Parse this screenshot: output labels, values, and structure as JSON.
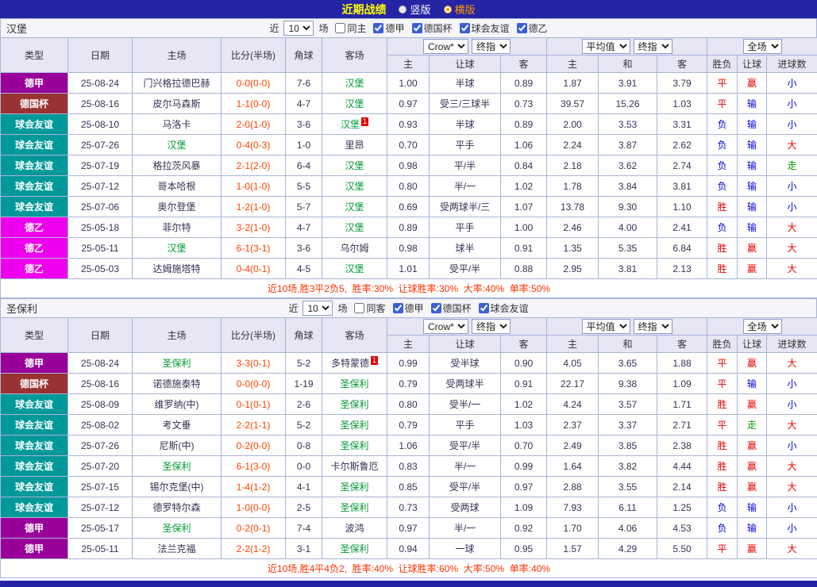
{
  "topbar": {
    "title": "近期战绩",
    "vertical_label": "竖版",
    "horizontal_label": "横版"
  },
  "columns": {
    "main": [
      "类型",
      "日期",
      "主场",
      "比分(半场)",
      "角球",
      "客场"
    ],
    "group1_selects": [
      "Crow*",
      "终指"
    ],
    "group1_cols": [
      "主",
      "让球",
      "客"
    ],
    "group2_selects": [
      "平均值",
      "终指"
    ],
    "group2_cols": [
      "主",
      "和",
      "客"
    ],
    "group3_selects": [
      "全场"
    ],
    "group3_cols": [
      "胜负",
      "让球",
      "进球数"
    ]
  },
  "league_colors": {
    "德甲": "#990099",
    "德国杯": "#993333",
    "球会友谊": "#009999",
    "德乙": "#ee00ee"
  },
  "colors": {
    "topbar-bg": "#2424a4",
    "title": "#ffff00",
    "radio-selected": "#ff9900",
    "border": "#a9b4d8",
    "header-bg": "#e6e6f4",
    "bar-bg": "#f5f5fa",
    "score": "#ff4400",
    "focus": "#009933",
    "dark": "#333355",
    "res-red": "#e60000",
    "res-blue": "#0000dd",
    "res-green": "#009900",
    "summary": "#ff3300"
  },
  "sections": [
    {
      "team": "汉堡",
      "filter": {
        "near": "近",
        "count": "10",
        "unit": "场",
        "checks": [
          {
            "label": "同主",
            "checked": false
          },
          {
            "label": "德甲",
            "checked": true
          },
          {
            "label": "德国杯",
            "checked": true
          },
          {
            "label": "球会友谊",
            "checked": true
          },
          {
            "label": "德乙",
            "checked": true
          }
        ]
      },
      "rows": [
        {
          "league": "德甲",
          "date": "25-08-24",
          "home": "门兴格拉德巴赫",
          "home_focus": false,
          "home_card": "",
          "score": "0-0(0-0)",
          "corner": "7-6",
          "away": "汉堡",
          "away_focus": true,
          "away_card": "",
          "o1": "1.00",
          "hcp": "半球",
          "o2": "0.89",
          "m1": "1.87",
          "m2": "3.91",
          "m3": "3.79",
          "res": "平",
          "resC": "red",
          "let": "赢",
          "letC": "red",
          "goal": "小",
          "goalC": "blue"
        },
        {
          "league": "德国杯",
          "date": "25-08-16",
          "home": "皮尔马森斯",
          "home_focus": false,
          "home_card": "",
          "score": "1-1(0-0)",
          "corner": "4-7",
          "away": "汉堡",
          "away_focus": true,
          "away_card": "",
          "o1": "0.97",
          "hcp": "受三/三球半",
          "o2": "0.73",
          "m1": "39.57",
          "m2": "15.26",
          "m3": "1.03",
          "res": "平",
          "resC": "red",
          "let": "输",
          "letC": "blue",
          "goal": "小",
          "goalC": "blue"
        },
        {
          "league": "球会友谊",
          "date": "25-08-10",
          "home": "马洛卡",
          "home_focus": false,
          "home_card": "",
          "score": "2-0(1-0)",
          "corner": "3-6",
          "away": "汉堡",
          "away_focus": true,
          "away_card": "1",
          "o1": "0.93",
          "hcp": "半球",
          "o2": "0.89",
          "m1": "2.00",
          "m2": "3.53",
          "m3": "3.31",
          "res": "负",
          "resC": "blue",
          "let": "输",
          "letC": "blue",
          "goal": "小",
          "goalC": "blue"
        },
        {
          "league": "球会友谊",
          "date": "25-07-26",
          "home": "汉堡",
          "home_focus": true,
          "home_card": "",
          "score": "0-4(0-3)",
          "corner": "1-0",
          "away": "里昂",
          "away_focus": false,
          "away_card": "",
          "o1": "0.70",
          "hcp": "平手",
          "o2": "1.06",
          "m1": "2.24",
          "m2": "3.87",
          "m3": "2.62",
          "res": "负",
          "resC": "blue",
          "let": "输",
          "letC": "blue",
          "goal": "大",
          "goalC": "red"
        },
        {
          "league": "球会友谊",
          "date": "25-07-19",
          "home": "格拉茨风暴",
          "home_focus": false,
          "home_card": "",
          "score": "2-1(2-0)",
          "corner": "6-4",
          "away": "汉堡",
          "away_focus": true,
          "away_card": "",
          "o1": "0.98",
          "hcp": "平/半",
          "o2": "0.84",
          "m1": "2.18",
          "m2": "3.62",
          "m3": "2.74",
          "res": "负",
          "resC": "blue",
          "let": "输",
          "letC": "blue",
          "goal": "走",
          "goalC": "green"
        },
        {
          "league": "球会友谊",
          "date": "25-07-12",
          "home": "哥本哈根",
          "home_focus": false,
          "home_card": "",
          "score": "1-0(1-0)",
          "corner": "5-5",
          "away": "汉堡",
          "away_focus": true,
          "away_card": "",
          "o1": "0.80",
          "hcp": "半/一",
          "o2": "1.02",
          "m1": "1.78",
          "m2": "3.84",
          "m3": "3.81",
          "res": "负",
          "resC": "blue",
          "let": "输",
          "letC": "blue",
          "goal": "小",
          "goalC": "blue"
        },
        {
          "league": "球会友谊",
          "date": "25-07-06",
          "home": "奥尔登堡",
          "home_focus": false,
          "home_card": "",
          "score": "1-2(1-0)",
          "corner": "5-7",
          "away": "汉堡",
          "away_focus": true,
          "away_card": "",
          "o1": "0.69",
          "hcp": "受两球半/三",
          "o2": "1.07",
          "m1": "13.78",
          "m2": "9.30",
          "m3": "1.10",
          "res": "胜",
          "resC": "red",
          "let": "输",
          "letC": "blue",
          "goal": "小",
          "goalC": "blue"
        },
        {
          "league": "德乙",
          "date": "25-05-18",
          "home": "菲尔特",
          "home_focus": false,
          "home_card": "",
          "score": "3-2(1-0)",
          "corner": "4-7",
          "away": "汉堡",
          "away_focus": true,
          "away_card": "",
          "o1": "0.89",
          "hcp": "平手",
          "o2": "1.00",
          "m1": "2.46",
          "m2": "4.00",
          "m3": "2.41",
          "res": "负",
          "resC": "blue",
          "let": "输",
          "letC": "blue",
          "goal": "大",
          "goalC": "red"
        },
        {
          "league": "德乙",
          "date": "25-05-11",
          "home": "汉堡",
          "home_focus": true,
          "home_card": "",
          "score": "6-1(3-1)",
          "corner": "3-6",
          "away": "乌尔姆",
          "away_focus": false,
          "away_card": "",
          "o1": "0.98",
          "hcp": "球半",
          "o2": "0.91",
          "m1": "1.35",
          "m2": "5.35",
          "m3": "6.84",
          "res": "胜",
          "resC": "red",
          "let": "赢",
          "letC": "red",
          "goal": "大",
          "goalC": "red"
        },
        {
          "league": "德乙",
          "date": "25-05-03",
          "home": "达姆施塔特",
          "home_focus": false,
          "home_card": "",
          "score": "0-4(0-1)",
          "corner": "4-5",
          "away": "汉堡",
          "away_focus": true,
          "away_card": "",
          "o1": "1.01",
          "hcp": "受平/半",
          "o2": "0.88",
          "m1": "2.95",
          "m2": "3.81",
          "m3": "2.13",
          "res": "胜",
          "resC": "red",
          "let": "赢",
          "letC": "red",
          "goal": "大",
          "goalC": "red"
        }
      ],
      "summary": "近10场,胜3平2负5,  胜率:30%  让球胜率:30%  大率:40%  单率:50%"
    },
    {
      "team": "圣保利",
      "filter": {
        "near": "近",
        "count": "10",
        "unit": "场",
        "checks": [
          {
            "label": "同客",
            "checked": false
          },
          {
            "label": "德甲",
            "checked": true
          },
          {
            "label": "德国杯",
            "checked": true
          },
          {
            "label": "球会友谊",
            "checked": true
          }
        ]
      },
      "rows": [
        {
          "league": "德甲",
          "date": "25-08-24",
          "home": "圣保利",
          "home_focus": true,
          "home_card": "",
          "score": "3-3(0-1)",
          "corner": "5-2",
          "away": "多特蒙德",
          "away_focus": false,
          "away_card": "1",
          "o1": "0.99",
          "hcp": "受半球",
          "o2": "0.90",
          "m1": "4.05",
          "m2": "3.65",
          "m3": "1.88",
          "res": "平",
          "resC": "red",
          "let": "赢",
          "letC": "red",
          "goal": "大",
          "goalC": "red"
        },
        {
          "league": "德国杯",
          "date": "25-08-16",
          "home": "诺德施泰特",
          "home_focus": false,
          "home_card": "",
          "score": "0-0(0-0)",
          "corner": "1-19",
          "away": "圣保利",
          "away_focus": true,
          "away_card": "",
          "o1": "0.79",
          "hcp": "受两球半",
          "o2": "0.91",
          "m1": "22.17",
          "m2": "9.38",
          "m3": "1.09",
          "res": "平",
          "resC": "red",
          "let": "输",
          "letC": "blue",
          "goal": "小",
          "goalC": "blue"
        },
        {
          "league": "球会友谊",
          "date": "25-08-09",
          "home": "维罗纳(中)",
          "home_focus": false,
          "home_card": "",
          "score": "0-1(0-1)",
          "corner": "2-6",
          "away": "圣保利",
          "away_focus": true,
          "away_card": "",
          "o1": "0.80",
          "hcp": "受半/一",
          "o2": "1.02",
          "m1": "4.24",
          "m2": "3.57",
          "m3": "1.71",
          "res": "胜",
          "resC": "red",
          "let": "赢",
          "letC": "red",
          "goal": "小",
          "goalC": "blue"
        },
        {
          "league": "球会友谊",
          "date": "25-08-02",
          "home": "考文垂",
          "home_focus": false,
          "home_card": "",
          "score": "2-2(1-1)",
          "corner": "5-2",
          "away": "圣保利",
          "away_focus": true,
          "away_card": "",
          "o1": "0.79",
          "hcp": "平手",
          "o2": "1.03",
          "m1": "2.37",
          "m2": "3.37",
          "m3": "2.71",
          "res": "平",
          "resC": "red",
          "let": "走",
          "letC": "green",
          "goal": "大",
          "goalC": "red"
        },
        {
          "league": "球会友谊",
          "date": "25-07-26",
          "home": "尼斯(中)",
          "home_focus": false,
          "home_card": "",
          "score": "0-2(0-0)",
          "corner": "0-8",
          "away": "圣保利",
          "away_focus": true,
          "away_card": "",
          "o1": "1.06",
          "hcp": "受平/半",
          "o2": "0.70",
          "m1": "2.49",
          "m2": "3.85",
          "m3": "2.38",
          "res": "胜",
          "resC": "red",
          "let": "赢",
          "letC": "red",
          "goal": "小",
          "goalC": "blue"
        },
        {
          "league": "球会友谊",
          "date": "25-07-20",
          "home": "圣保利",
          "home_focus": true,
          "home_card": "",
          "score": "6-1(3-0)",
          "corner": "0-0",
          "away": "卡尔斯鲁厄",
          "away_focus": false,
          "away_card": "",
          "o1": "0.83",
          "hcp": "半/一",
          "o2": "0.99",
          "m1": "1.64",
          "m2": "3.82",
          "m3": "4.44",
          "res": "胜",
          "resC": "red",
          "let": "赢",
          "letC": "red",
          "goal": "大",
          "goalC": "red"
        },
        {
          "league": "球会友谊",
          "date": "25-07-15",
          "home": "锡尔克堡(中)",
          "home_focus": false,
          "home_card": "",
          "score": "1-4(1-2)",
          "corner": "4-1",
          "away": "圣保利",
          "away_focus": true,
          "away_card": "",
          "o1": "0.85",
          "hcp": "受平/半",
          "o2": "0.97",
          "m1": "2.88",
          "m2": "3.55",
          "m3": "2.14",
          "res": "胜",
          "resC": "red",
          "let": "赢",
          "letC": "red",
          "goal": "大",
          "goalC": "red"
        },
        {
          "league": "球会友谊",
          "date": "25-07-12",
          "home": "德罗特尔森",
          "home_focus": false,
          "home_card": "",
          "score": "1-0(0-0)",
          "corner": "2-5",
          "away": "圣保利",
          "away_focus": true,
          "away_card": "",
          "o1": "0.73",
          "hcp": "受两球",
          "o2": "1.09",
          "m1": "7.93",
          "m2": "6.11",
          "m3": "1.25",
          "res": "负",
          "resC": "blue",
          "let": "输",
          "letC": "blue",
          "goal": "小",
          "goalC": "blue"
        },
        {
          "league": "德甲",
          "date": "25-05-17",
          "home": "圣保利",
          "home_focus": true,
          "home_card": "",
          "score": "0-2(0-1)",
          "corner": "7-4",
          "away": "波鸿",
          "away_focus": false,
          "away_card": "",
          "o1": "0.97",
          "hcp": "半/一",
          "o2": "0.92",
          "m1": "1.70",
          "m2": "4.06",
          "m3": "4.53",
          "res": "负",
          "resC": "blue",
          "let": "输",
          "letC": "blue",
          "goal": "小",
          "goalC": "blue"
        },
        {
          "league": "德甲",
          "date": "25-05-11",
          "home": "法兰克福",
          "home_focus": false,
          "home_card": "",
          "score": "2-2(1-2)",
          "corner": "3-1",
          "away": "圣保利",
          "away_focus": true,
          "away_card": "",
          "o1": "0.94",
          "hcp": "一球",
          "o2": "0.95",
          "m1": "1.57",
          "m2": "4.29",
          "m3": "5.50",
          "res": "平",
          "resC": "red",
          "let": "赢",
          "letC": "red",
          "goal": "大",
          "goalC": "red"
        }
      ],
      "summary": "近10场,胜4平4负2,  胜率:40%  让球胜率:60%  大率:50%  单率:40%"
    }
  ]
}
